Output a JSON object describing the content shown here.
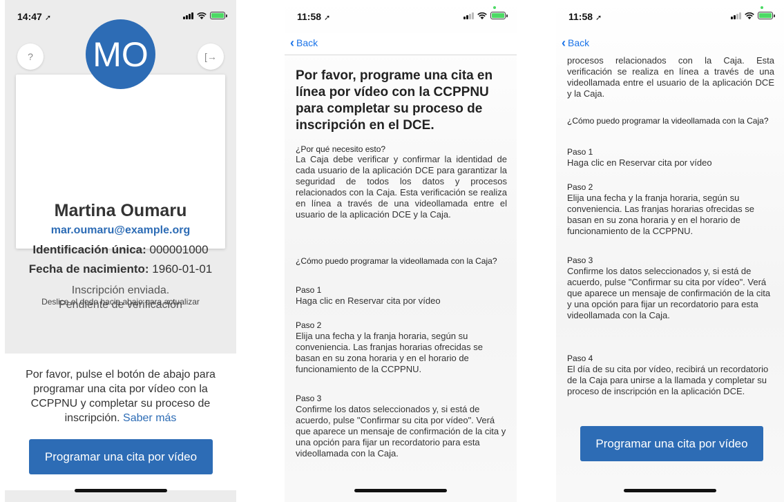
{
  "screen1": {
    "time": "14:47",
    "help_label": "?",
    "logout_label": "[→",
    "initials": "MO",
    "name": "Martina Oumaru",
    "email": "mar.oumaru@example.org",
    "id_label": "Identificación única:",
    "id_value": "000001000",
    "dob_label": "Fecha de nacimiento:",
    "dob_value": "1960-01-01",
    "status_line1": "Inscripción enviada.",
    "status_line2": "Pendiente de verificación",
    "swipe_hint": "Deslice el dedo hacia abajo para actualizar",
    "prompt_text": "Por favor, pulse el botón de abajo para programar una cita por vídeo con la CCPPNU y completar su proceso de inscripción.",
    "learn_more": "Saber más",
    "button": "Programar una cita por vídeo"
  },
  "screen2": {
    "time": "11:58",
    "back": "Back",
    "heading": "Por favor, programe una cita en línea por vídeo con la CCPPNU para completar su proceso de inscripción en el DCE.",
    "why_q": "¿Por qué necesito esto?",
    "why_a": "La Caja debe verificar y confirmar la identidad de cada usuario de la aplicación DCE para garantizar la seguridad de todos los datos y procesos relacionados con la Caja. Esta verificación se realiza en línea a través de una videollamada entre el usuario de la aplicación DCE y la Caja.",
    "how_q": "¿Cómo puedo programar la videollamada con la Caja?",
    "step1_t": "Paso 1",
    "step1_d": "Haga clic en Reservar cita por vídeo",
    "step2_t": "Paso 2",
    "step2_d": "Elija una fecha y la franja horaria, según su conveniencia. Las franjas horarias ofrecidas se basan en su zona horaria y en el horario de funcionamiento de la CCPPNU.",
    "step3_t": "Paso 3",
    "step3_d": "Confirme los datos seleccionados y, si está de acuerdo, pulse \"Confirmar su cita por vídeo\". Verá que aparece un mensaje de confirmación de la cita y una opción para fijar un recordatorio para esta videollamada con la Caja."
  },
  "screen3": {
    "time": "11:58",
    "back": "Back",
    "top_text": "procesos relacionados con la Caja. Esta verificación se realiza en línea a través de una videollamada entre el usuario de la aplicación DCE y la Caja.",
    "how_q": "¿Cómo puedo programar la videollamada con la Caja?",
    "step1_t": "Paso 1",
    "step1_d": "Haga clic en Reservar cita por vídeo",
    "step2_t": "Paso 2",
    "step2_d": "Elija una fecha y la franja horaria, según su conveniencia. Las franjas horarias ofrecidas se basan en su zona horaria y en el horario de funcionamiento de la CCPPNU.",
    "step3_t": "Paso 3",
    "step3_d": "Confirme los datos seleccionados y, si está de acuerdo, pulse \"Confirmar su cita por vídeo\". Verá que aparece un mensaje de confirmación de la cita y una opción para fijar un recordatorio para esta videollamada con la Caja.",
    "step4_t": "Paso 4",
    "step4_d": "El día de su cita por vídeo, recibirá un recordatorio de la Caja para unirse a la llamada y completar su proceso de inscripción en la aplicación DCE.",
    "button": "Programar una cita por vídeo"
  },
  "colors": {
    "accent": "#2d6cb5",
    "link": "#1a73e8",
    "battery": "#4cd964"
  },
  "icons": [
    "location-arrow-icon",
    "signal-icon",
    "wifi-icon",
    "battery-charging-icon",
    "chevron-left-icon",
    "help-icon",
    "logout-icon"
  ]
}
